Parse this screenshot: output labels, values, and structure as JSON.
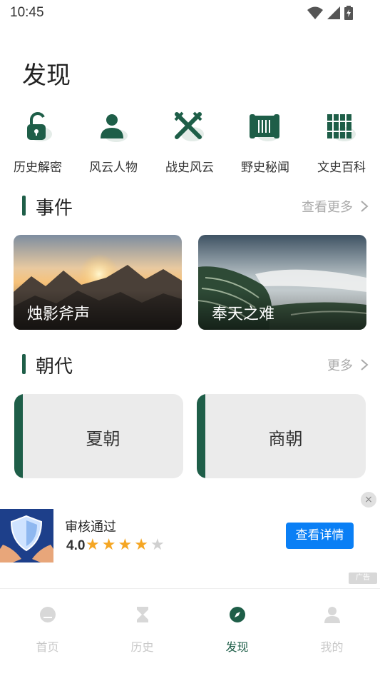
{
  "status_bar": {
    "time": "10:45",
    "icons": [
      "wifi-icon",
      "signal-icon",
      "battery-icon"
    ]
  },
  "page": {
    "title": "发现"
  },
  "categories": [
    {
      "label": "历史解密",
      "icon": "unlock-icon"
    },
    {
      "label": "风云人物",
      "icon": "person-icon"
    },
    {
      "label": "战史风云",
      "icon": "crossed-swords-icon"
    },
    {
      "label": "野史秘闻",
      "icon": "scroll-icon"
    },
    {
      "label": "文史百科",
      "icon": "bamboo-slips-icon"
    }
  ],
  "events_section": {
    "title": "事件",
    "more": "查看更多",
    "cards": [
      {
        "label": "烛影斧声",
        "image": "mountain-sunset-photo"
      },
      {
        "label": "奉天之难",
        "image": "terraced-fields-photo"
      }
    ]
  },
  "dynasty_section": {
    "title": "朝代",
    "more": "更多",
    "cards": [
      {
        "label": "夏朝"
      },
      {
        "label": "商朝"
      }
    ]
  },
  "ad": {
    "title": "审核通过",
    "rating": "4.0",
    "stars_filled": 4,
    "stars_total": 5,
    "cta": "查看详情",
    "close": "×",
    "ad_mark": "广告"
  },
  "tab_bar": {
    "items": [
      {
        "label": "首页",
        "icon": "home-icon",
        "active": false
      },
      {
        "label": "历史",
        "icon": "hourglass-icon",
        "active": false
      },
      {
        "label": "发现",
        "icon": "compass-icon",
        "active": true
      },
      {
        "label": "我的",
        "icon": "profile-icon",
        "active": false
      }
    ]
  },
  "colors": {
    "brand": "#1e5e48",
    "cta": "#0a7ff5",
    "star": "#f5a623",
    "card_bg": "#ebebeb"
  }
}
